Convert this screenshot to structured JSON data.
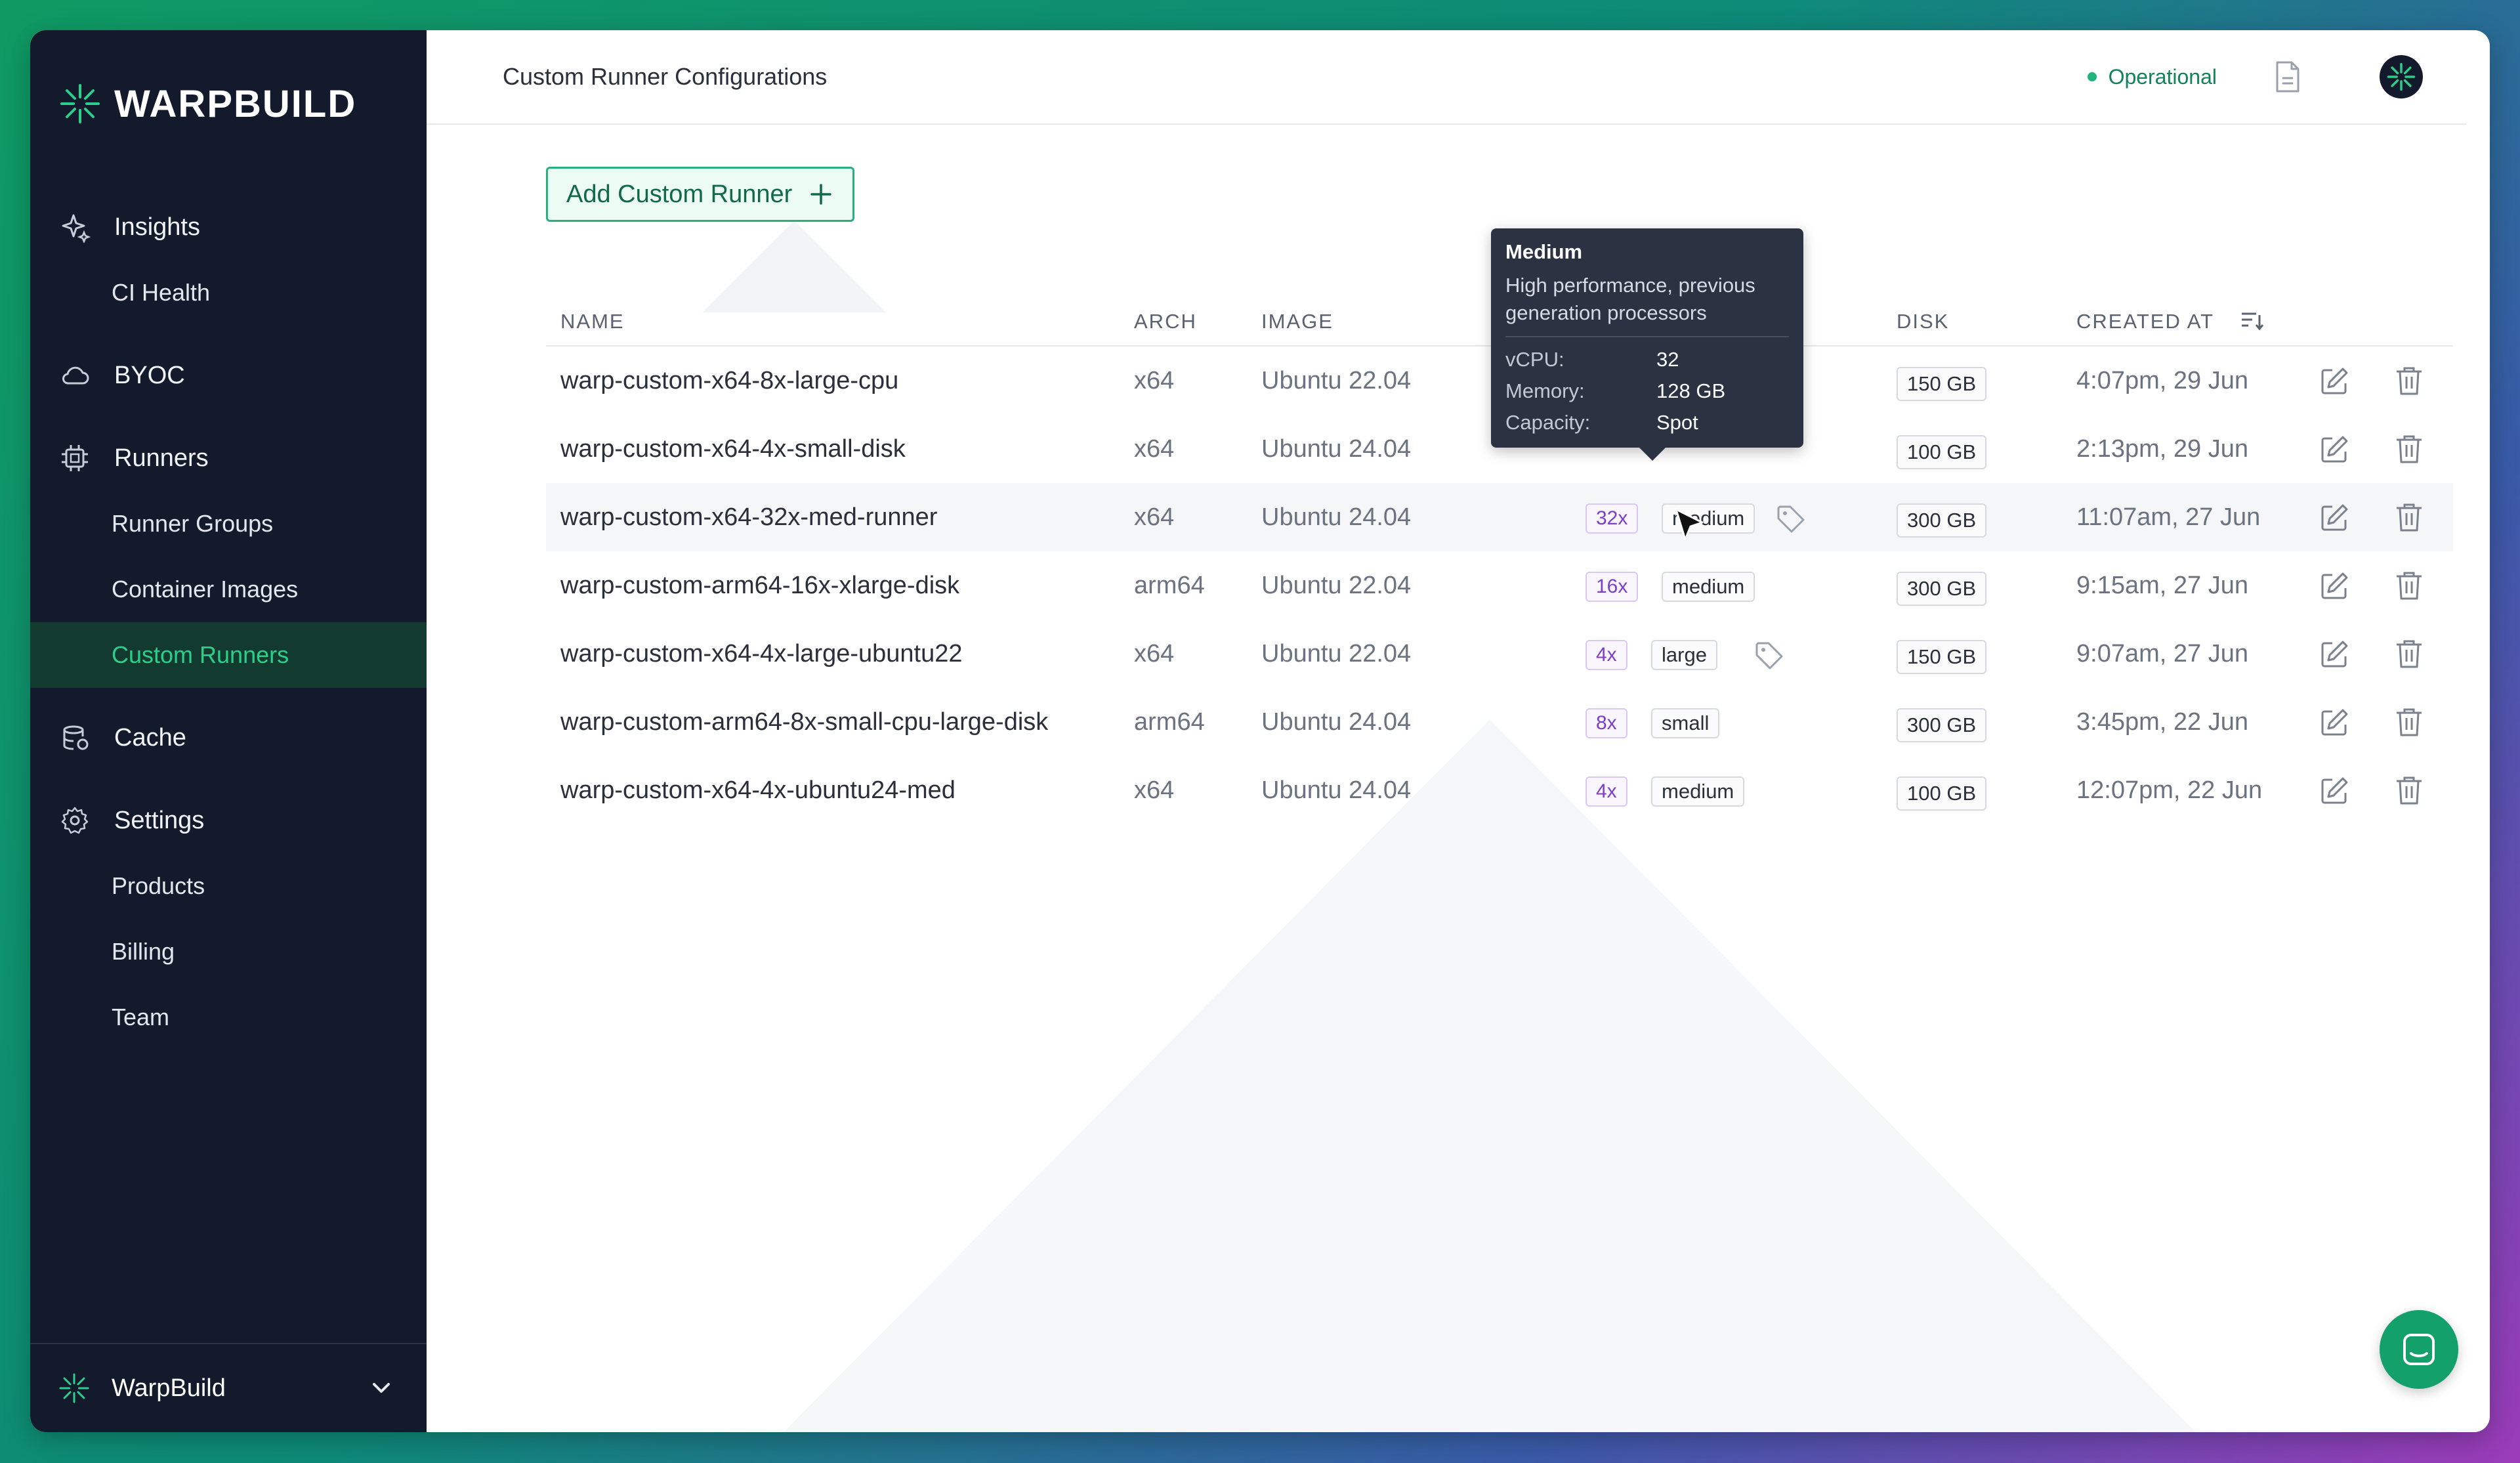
{
  "brand": {
    "name": "WARPBUILD"
  },
  "sidebar": {
    "sections": [
      {
        "label": "Insights",
        "icon": "sparkle-icon",
        "items": [
          "CI Health"
        ]
      },
      {
        "label": "BYOC",
        "icon": "cloud-icon",
        "items": []
      },
      {
        "label": "Runners",
        "icon": "cpu-icon",
        "items": [
          "Runner Groups",
          "Container Images",
          "Custom Runners"
        ]
      },
      {
        "label": "Cache",
        "icon": "database-icon",
        "items": []
      },
      {
        "label": "Settings",
        "icon": "gear-icon",
        "items": [
          "Products",
          "Billing",
          "Team"
        ]
      }
    ],
    "active_item": "Custom Runners",
    "footer": {
      "org_name": "WarpBuild"
    }
  },
  "header": {
    "title": "Custom Runner Configurations",
    "status": "Operational",
    "status_color": "#1fb57a"
  },
  "toolbar": {
    "add_label": "Add Custom Runner"
  },
  "table": {
    "columns": {
      "name": "NAME",
      "arch": "ARCH",
      "image": "IMAGE",
      "disk": "DISK",
      "created_at": "CREATED AT"
    },
    "rows": [
      {
        "name": "warp-custom-x64-8x-large-cpu",
        "arch": "x64",
        "image": "Ubuntu 22.04",
        "size": "",
        "tier": "",
        "spot": false,
        "disk": "150 GB",
        "created_at": "4:07pm, 29 Jun"
      },
      {
        "name": "warp-custom-x64-4x-small-disk",
        "arch": "x64",
        "image": "Ubuntu 24.04",
        "size": "",
        "tier": "",
        "spot": false,
        "disk": "100 GB",
        "created_at": "2:13pm, 29 Jun"
      },
      {
        "name": "warp-custom-x64-32x-med-runner",
        "arch": "x64",
        "image": "Ubuntu 24.04",
        "size": "32x",
        "tier": "medium",
        "spot": true,
        "disk": "300 GB",
        "created_at": "11:07am, 27 Jun"
      },
      {
        "name": "warp-custom-arm64-16x-xlarge-disk",
        "arch": "arm64",
        "image": "Ubuntu 22.04",
        "size": "16x",
        "tier": "medium",
        "spot": false,
        "disk": "300 GB",
        "created_at": "9:15am, 27 Jun"
      },
      {
        "name": "warp-custom-x64-4x-large-ubuntu22",
        "arch": "x64",
        "image": "Ubuntu 22.04",
        "size": "4x",
        "tier": "large",
        "spot": true,
        "disk": "150 GB",
        "created_at": "9:07am, 27 Jun"
      },
      {
        "name": "warp-custom-arm64-8x-small-cpu-large-disk",
        "arch": "arm64",
        "image": "Ubuntu 24.04",
        "size": "8x",
        "tier": "small",
        "spot": false,
        "disk": "300 GB",
        "created_at": "3:45pm, 22 Jun"
      },
      {
        "name": "warp-custom-x64-4x-ubuntu24-med",
        "arch": "x64",
        "image": "Ubuntu 24.04",
        "size": "4x",
        "tier": "medium",
        "spot": false,
        "disk": "100 GB",
        "created_at": "12:07pm, 22 Jun"
      }
    ]
  },
  "tooltip": {
    "title": "Medium",
    "description": "High performance, previous generation processors",
    "specs": [
      {
        "key": "vCPU:",
        "value": "32"
      },
      {
        "key": "Memory:",
        "value": "128 GB"
      },
      {
        "key": "Capacity:",
        "value": "Spot"
      }
    ]
  },
  "colors": {
    "accent": "#13a06b",
    "sidebar_bg": "#121a2b",
    "size_tag": "#7b3fc9"
  }
}
